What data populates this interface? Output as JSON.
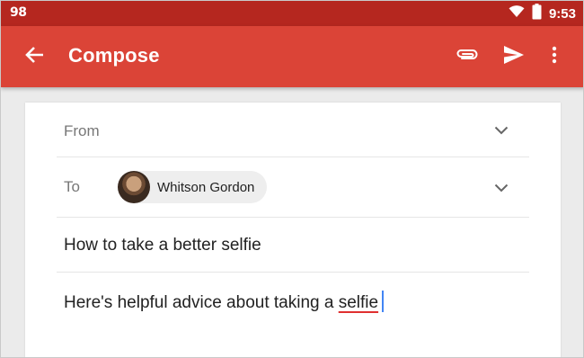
{
  "status_bar": {
    "left_indicator": "98",
    "time": "9:53",
    "colors": {
      "background": "#b5271f"
    }
  },
  "app_bar": {
    "title": "Compose",
    "back_icon": "arrow-back-icon",
    "attach_icon": "paperclip-icon",
    "send_icon": "send-icon",
    "more_icon": "more-vert-icon",
    "colors": {
      "background": "#db4437"
    }
  },
  "compose": {
    "from_label": "From",
    "to_label": "To",
    "recipient": {
      "name": "Whitson Gordon"
    },
    "subject": "How to take a better selfie",
    "body_prefix": "Here's helpful advice about taking a ",
    "body_misspelled_word": "selfie"
  }
}
